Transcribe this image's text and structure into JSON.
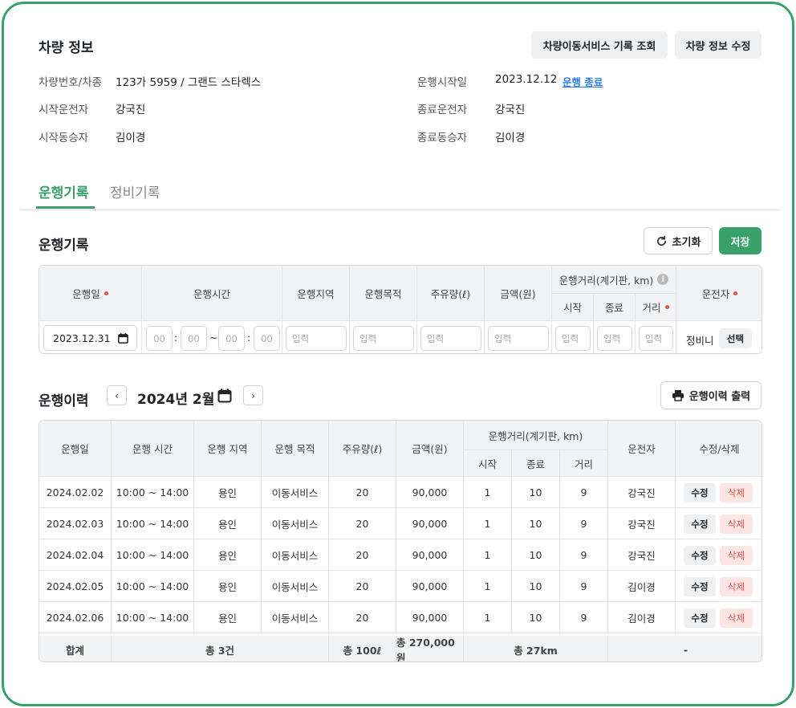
{
  "vehicle": {
    "title": "차량 정보",
    "btn_history": "차량이동서비스 기록 조회",
    "btn_edit": "차량 정보 수정",
    "fields_left": [
      {
        "label": "차량번호/차종",
        "value": "123가 5959 / 그랜드 스타렉스"
      },
      {
        "label": "시작운전자",
        "value": "강국진"
      },
      {
        "label": "시작동승자",
        "value": "김이경"
      }
    ],
    "fields_right": [
      {
        "label": "운행시작일",
        "value": "2023.12.12"
      },
      {
        "label": "종료운전자",
        "value": "강국진"
      },
      {
        "label": "종료동승자",
        "value": "김이경"
      }
    ],
    "end_link": "운행 종료"
  },
  "tabs": [
    {
      "label": "운행기록"
    },
    {
      "label": "정비기록"
    }
  ],
  "log": {
    "title": "운행기록",
    "reset": "초기화",
    "save": "저장",
    "headers": {
      "date": "운행일",
      "time": "운행시간",
      "region": "운행지역",
      "purpose": "운행목적",
      "fuel": "주유량(ℓ)",
      "amount": "금액(원)",
      "distance": "운행거리(계기판, km)",
      "start": "시작",
      "end": "종료",
      "dist": "거리",
      "driver": "운전자"
    },
    "date_value": "2023.12.31",
    "time_ph": [
      "00",
      "00",
      "00",
      "00"
    ],
    "colon": ":",
    "tilde": "~",
    "input_ph": "입력",
    "driver_value": "정비니",
    "select": "선택"
  },
  "history": {
    "title": "운행이력",
    "month": "2024년 2월",
    "print": "운행이력 출력",
    "headers": {
      "date": "운행일",
      "time": "운행 시간",
      "region": "운행 지역",
      "purpose": "운행 목적",
      "fuel": "주유량(ℓ)",
      "amount": "금액(원)",
      "distance": "운행거리(계기판, km)",
      "start": "시작",
      "end": "종료",
      "dist": "거리",
      "driver": "운전자",
      "action": "수정/삭제"
    },
    "rows": [
      {
        "date": "2024.02.02",
        "time": "10:00 ~ 14:00",
        "region": "용인",
        "purpose": "이동서비스",
        "fuel": "20",
        "amount": "90,000",
        "start": "1",
        "end": "10",
        "dist": "9",
        "driver": "강국진"
      },
      {
        "date": "2024.02.03",
        "time": "10:00 ~ 14:00",
        "region": "용인",
        "purpose": "이동서비스",
        "fuel": "20",
        "amount": "90,000",
        "start": "1",
        "end": "10",
        "dist": "9",
        "driver": "강국진"
      },
      {
        "date": "2024.02.04",
        "time": "10:00 ~ 14:00",
        "region": "용인",
        "purpose": "이동서비스",
        "fuel": "20",
        "amount": "90,000",
        "start": "1",
        "end": "10",
        "dist": "9",
        "driver": "강국진"
      },
      {
        "date": "2024.02.05",
        "time": "10:00 ~ 14:00",
        "region": "용인",
        "purpose": "이동서비스",
        "fuel": "20",
        "amount": "90,000",
        "start": "1",
        "end": "10",
        "dist": "9",
        "driver": "김이경"
      },
      {
        "date": "2024.02.06",
        "time": "10:00 ~ 14:00",
        "region": "용인",
        "purpose": "이동서비스",
        "fuel": "20",
        "amount": "90,000",
        "start": "1",
        "end": "10",
        "dist": "9",
        "driver": "김이경"
      }
    ],
    "edit": "수정",
    "delete": "삭제",
    "total": {
      "label": "합계",
      "count": "총 3건",
      "fuel": "총 100ℓ",
      "amount": "총 270,000원",
      "distance": "총 27km",
      "rest": "-"
    }
  }
}
